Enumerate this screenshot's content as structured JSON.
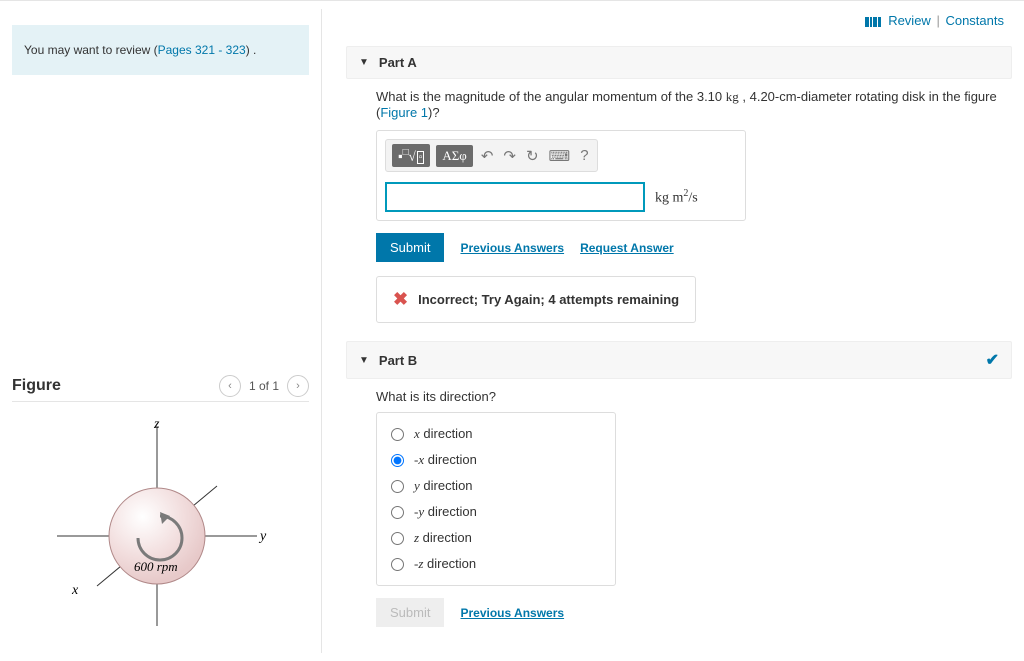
{
  "hint": {
    "prefix": "You may want to review (",
    "link": "Pages 321 - 323",
    "suffix": ") ."
  },
  "figure": {
    "heading": "Figure",
    "counter": "1 of 1",
    "axes": {
      "x": "x",
      "y": "y",
      "z": "z"
    },
    "label": "600 rpm"
  },
  "toplinks": {
    "review": "Review",
    "constants": "Constants",
    "sep": "|"
  },
  "partA": {
    "title": "Part A",
    "question_pre": "What is the magnitude of the angular momentum of the 3.10 ",
    "kg": "kg",
    "question_mid": " , 4.20-cm-diameter rotating disk in the figure (",
    "figlink": "Figure 1",
    "question_post": ")?",
    "toolbar": {
      "sqrt": "√",
      "greek": "ΑΣφ",
      "undo": "↶",
      "redo": "↷",
      "reset": "↻",
      "keyboard": "⌨",
      "help": "?"
    },
    "input_value": "",
    "unit_html": "kg m²/s",
    "submit": "Submit",
    "prev": "Previous Answers",
    "req": "Request Answer",
    "feedback": "Incorrect; Try Again; 4 attempts remaining"
  },
  "partB": {
    "title": "Part B",
    "question": "What is its direction?",
    "options": [
      {
        "label_var": "x",
        "label_rest": " direction",
        "checked": false
      },
      {
        "label_var": "-x",
        "label_rest": " direction",
        "checked": true
      },
      {
        "label_var": "y",
        "label_rest": " direction",
        "checked": false
      },
      {
        "label_var": "-y",
        "label_rest": " direction",
        "checked": false
      },
      {
        "label_var": "z",
        "label_rest": " direction",
        "checked": false
      },
      {
        "label_var": "-z",
        "label_rest": " direction",
        "checked": false
      }
    ],
    "submit": "Submit",
    "prev": "Previous Answers"
  }
}
